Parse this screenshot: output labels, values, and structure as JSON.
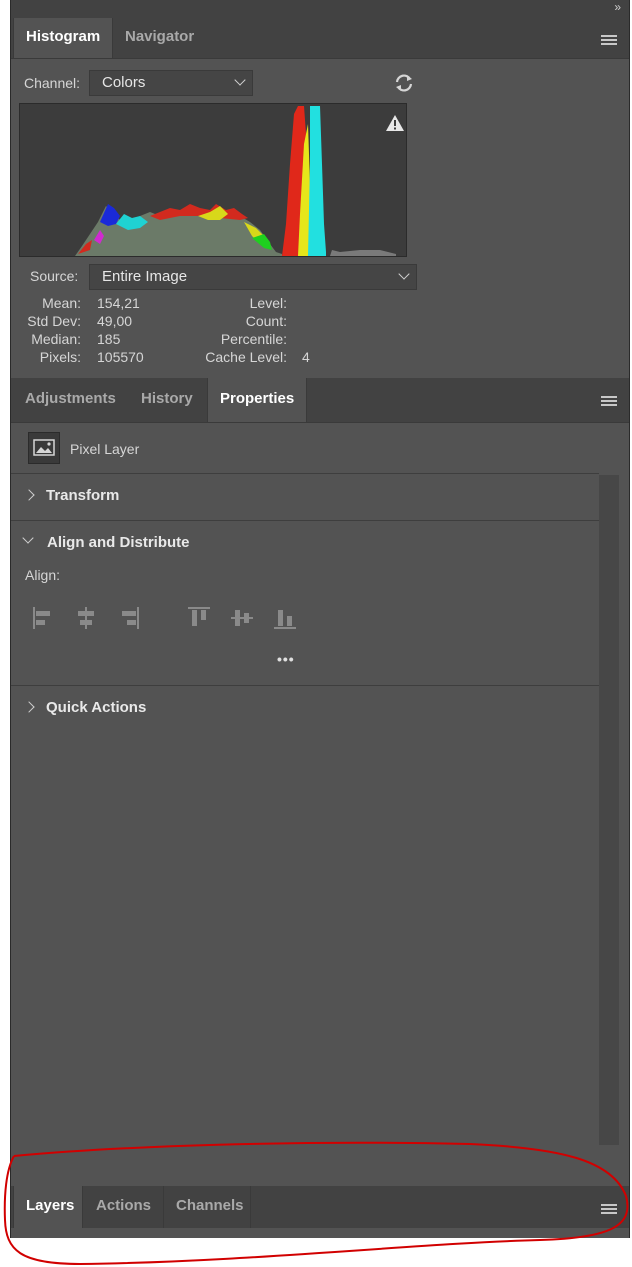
{
  "top_panel": {
    "collapse_glyph": "»",
    "tabs": [
      {
        "label": "Histogram",
        "active": true
      },
      {
        "label": "Navigator",
        "active": false
      }
    ]
  },
  "histogram": {
    "channel_label": "Channel:",
    "channel_value": "Colors",
    "source_label": "Source:",
    "source_value": "Entire Image",
    "stats": {
      "mean_label": "Mean:",
      "mean": "154,21",
      "std_label": "Std Dev:",
      "std": "49,00",
      "median_label": "Median:",
      "median": "185",
      "pixels_label": "Pixels:",
      "pixels": "105570",
      "level_label": "Level:",
      "level": "",
      "count_label": "Count:",
      "count": "",
      "percentile_label": "Percentile:",
      "percentile": "",
      "cache_label": "Cache Level:",
      "cache": "4"
    },
    "icons": {
      "refresh": "refresh-icon",
      "warning": "warning-icon"
    }
  },
  "properties_panel": {
    "tabs": [
      {
        "label": "Adjustments",
        "active": false
      },
      {
        "label": "History",
        "active": false
      },
      {
        "label": "Properties",
        "active": true
      }
    ],
    "layer_type": "Pixel Layer",
    "sections": {
      "transform": "Transform",
      "align": "Align and Distribute",
      "align_label": "Align:",
      "quick_actions": "Quick Actions",
      "more": "•••"
    }
  },
  "bottom_panel": {
    "tabs": [
      {
        "label": "Layers",
        "active": true
      },
      {
        "label": "Actions",
        "active": false
      },
      {
        "label": "Channels",
        "active": false
      }
    ]
  },
  "colors": {
    "panel_bg": "#535353",
    "tabbar_bg": "#424242",
    "annotation": "#d10000"
  }
}
